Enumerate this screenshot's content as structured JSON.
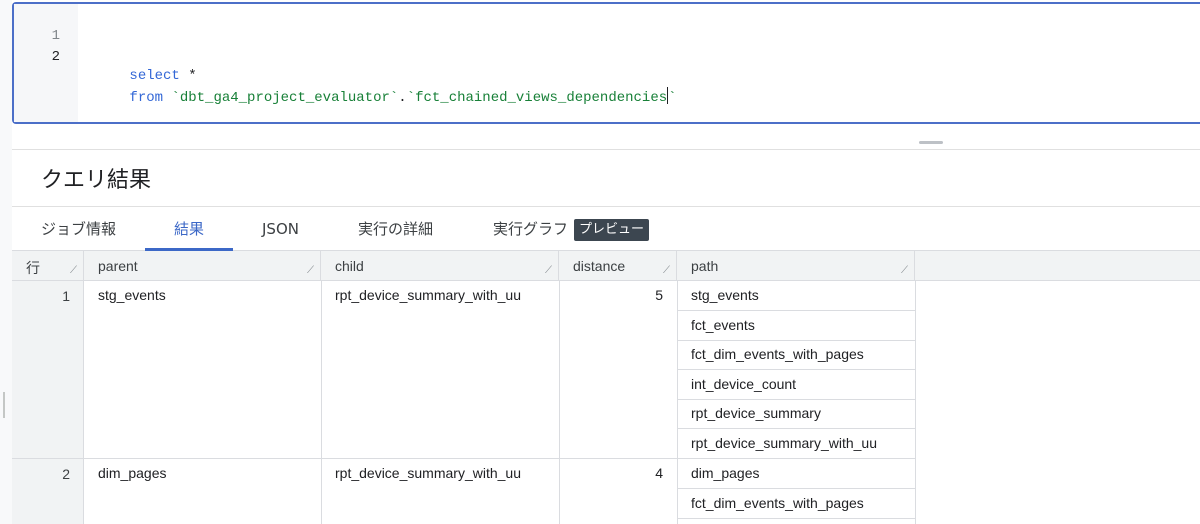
{
  "editor": {
    "line_numbers": [
      "1",
      "2"
    ],
    "line1": {
      "keyword": "select",
      "rest": " *"
    },
    "line2": {
      "keyword": "from",
      "space": " ",
      "project": "`dbt_ga4_project_evaluator`",
      "dot": ".",
      "table": "`fct_chained_views_dependencies",
      "closing": "`"
    }
  },
  "results": {
    "title": "クエリ結果",
    "tabs": [
      {
        "label": "ジョブ情報"
      },
      {
        "label": "結果"
      },
      {
        "label": "JSON"
      },
      {
        "label": "実行の詳細"
      },
      {
        "label": "実行グラフ",
        "badge": "プレビュー"
      }
    ],
    "active_tab": "結果",
    "columns": [
      "行",
      "parent",
      "child",
      "distance",
      "path"
    ],
    "rows": [
      {
        "row": "1",
        "parent": "stg_events",
        "child": "rpt_device_summary_with_uu",
        "distance": "5",
        "path": [
          "stg_events",
          "fct_events",
          "fct_dim_events_with_pages",
          "int_device_count",
          "rpt_device_summary",
          "rpt_device_summary_with_uu"
        ]
      },
      {
        "row": "2",
        "parent": "dim_pages",
        "child": "rpt_device_summary_with_uu",
        "distance": "4",
        "path": [
          "dim_pages",
          "fct_dim_events_with_pages"
        ]
      }
    ]
  },
  "colors": {
    "accent": "#3c68c7",
    "editor_border": "#4c6fc8",
    "keyword": "#3367d6",
    "string": "#188038"
  }
}
